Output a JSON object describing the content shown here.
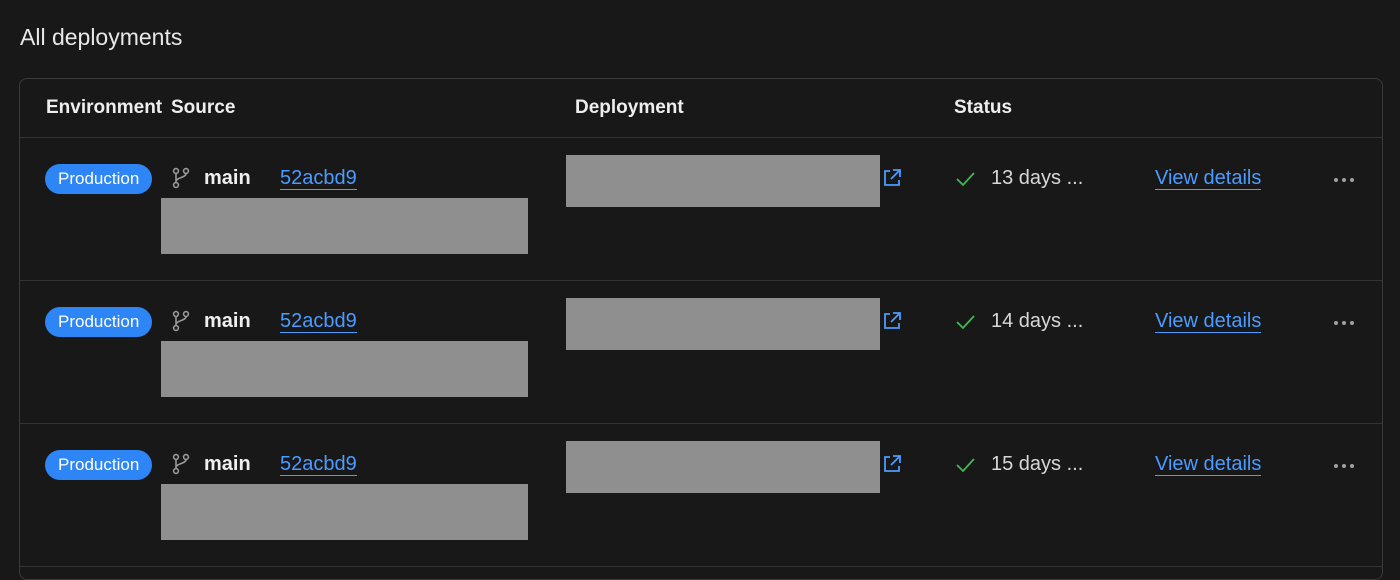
{
  "page": {
    "title": "All deployments"
  },
  "table": {
    "headers": {
      "environment": "Environment",
      "source": "Source",
      "deployment": "Deployment",
      "status": "Status"
    },
    "rows": [
      {
        "environment": "Production",
        "branch": "main",
        "commit": "52acbd9",
        "status_text": "13 days ...",
        "details_label": "View details"
      },
      {
        "environment": "Production",
        "branch": "main",
        "commit": "52acbd9",
        "status_text": "14 days ...",
        "details_label": "View details"
      },
      {
        "environment": "Production",
        "branch": "main",
        "commit": "52acbd9",
        "status_text": "15 days ...",
        "details_label": "View details"
      }
    ]
  },
  "colors": {
    "background": "#181818",
    "badge": "#2e85f5",
    "link": "#4c9bff",
    "success": "#3fb950",
    "redaction": "#8f8f8f"
  },
  "icons": [
    "git-branch-icon",
    "external-link-icon",
    "check-icon",
    "more-icon"
  ]
}
